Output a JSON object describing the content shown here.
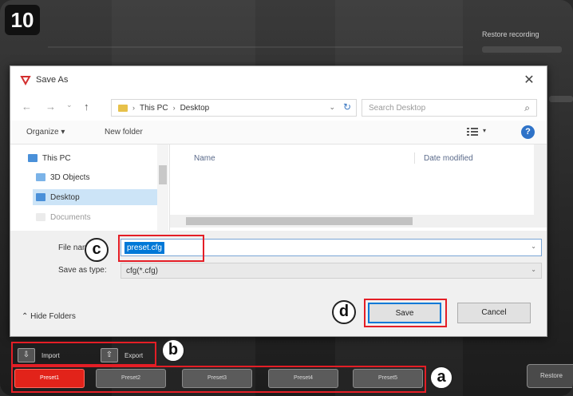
{
  "step_number": "10",
  "background": {
    "right_label": "Restore recording"
  },
  "dialog": {
    "title": "Save As",
    "nav": {
      "back": "←",
      "forward": "→",
      "up": "↑"
    },
    "address": {
      "root": "This PC",
      "folder": "Desktop"
    },
    "search_placeholder": "Search Desktop",
    "toolbar": {
      "organize": "Organize ▾",
      "new_folder": "New folder"
    },
    "tree": [
      {
        "label": "This PC",
        "color": "#4a90d9"
      },
      {
        "label": "3D Objects",
        "color": "#7bb3e8"
      },
      {
        "label": "Desktop",
        "color": "#4a90d9"
      },
      {
        "label": "Documents",
        "color": "#d8d8d8"
      }
    ],
    "columns": {
      "name": "Name",
      "date": "Date modified"
    },
    "file_name_label": "File name:",
    "file_name_value": "preset.cfg",
    "save_type_label": "Save as type:",
    "save_type_value": "cfg(*.cfg)",
    "hide_folders": "Hide Folders",
    "save_button": "Save",
    "cancel_button": "Cancel"
  },
  "app": {
    "import_label": "Import",
    "export_label": "Export",
    "presets": [
      "Preset1",
      "Preset2",
      "Preset3",
      "Preset4",
      "Preset5"
    ],
    "restore_label": "Restore"
  },
  "callouts": {
    "a": "a",
    "b": "b",
    "c": "c",
    "d": "d"
  },
  "colors": {
    "highlight_red": "#e41e26",
    "active_preset": "#e2231a",
    "selection_blue": "#0078d7"
  }
}
